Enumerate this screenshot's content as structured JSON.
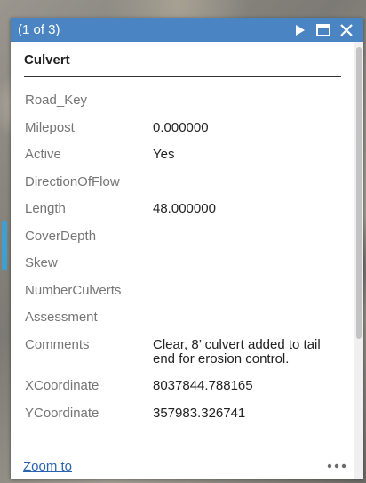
{
  "header": {
    "page_count": "(1 of 3)",
    "icons": [
      "play-icon",
      "maximize-icon",
      "close-icon"
    ]
  },
  "feature": {
    "title": "Culvert"
  },
  "attributes": [
    {
      "label": "Road_Key",
      "value": ""
    },
    {
      "label": "Milepost",
      "value": "0.000000"
    },
    {
      "label": "Active",
      "value": "Yes"
    },
    {
      "label": "DirectionOfFlow",
      "value": ""
    },
    {
      "label": "Length",
      "value": "48.000000"
    },
    {
      "label": "CoverDepth",
      "value": ""
    },
    {
      "label": "Skew",
      "value": ""
    },
    {
      "label": "NumberCulverts",
      "value": ""
    },
    {
      "label": "Assessment",
      "value": ""
    },
    {
      "label": "Comments",
      "value": "Clear, 8’ culvert added to tail end for erosion control."
    },
    {
      "label": "XCoordinate",
      "value": "8037844.788165"
    },
    {
      "label": "YCoordinate",
      "value": "357983.326741"
    }
  ],
  "footer": {
    "zoom_label": "Zoom to",
    "more_icon": "ellipsis-icon"
  },
  "colors": {
    "header_bg": "#4a84c2",
    "link": "#2a63b0",
    "label_text": "#757575",
    "value_text": "#222222"
  }
}
